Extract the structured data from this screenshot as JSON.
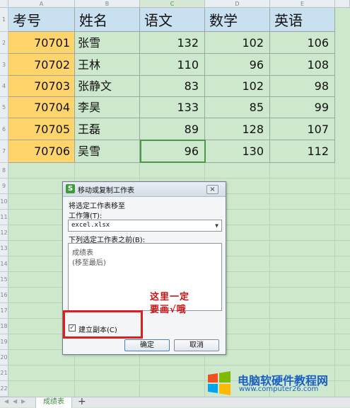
{
  "columns": [
    "A",
    "B",
    "C",
    "D",
    "E"
  ],
  "rows": [
    "1",
    "2",
    "3",
    "4",
    "5",
    "6",
    "7",
    "8",
    "9",
    "10",
    "11",
    "12",
    "13",
    "14",
    "15",
    "16",
    "17",
    "18",
    "19",
    "20",
    "21",
    "22"
  ],
  "table": {
    "headers": [
      "考号",
      "姓名",
      "语文",
      "数学",
      "英语"
    ],
    "records": [
      {
        "id": "70701",
        "name": "张雪",
        "chinese": "132",
        "math": "102",
        "english": "106"
      },
      {
        "id": "70702",
        "name": "王林",
        "chinese": "110",
        "math": "96",
        "english": "108"
      },
      {
        "id": "70703",
        "name": "张静文",
        "chinese": "83",
        "math": "102",
        "english": "98"
      },
      {
        "id": "70704",
        "name": "李昊",
        "chinese": "133",
        "math": "85",
        "english": "99"
      },
      {
        "id": "70705",
        "name": "王磊",
        "chinese": "89",
        "math": "128",
        "english": "107"
      },
      {
        "id": "70706",
        "name": "吴雪",
        "chinese": "96",
        "math": "130",
        "english": "112"
      }
    ]
  },
  "selected_column": "C",
  "dialog": {
    "title": "移动或复制工作表",
    "app_icon": "S",
    "close_icon": "×",
    "move_label": "将选定工作表移至",
    "workbook_label": "工作簿(T):",
    "workbook_value": "excel.xlsx",
    "before_label": "下列选定工作表之前(B):",
    "sheet_list": [
      "成绩表",
      "(移至最后)"
    ],
    "copy_label": "建立副本(C)",
    "copy_checked": true,
    "check_mark": "✓",
    "ok_label": "确定",
    "cancel_label": "取消"
  },
  "annotation": {
    "line1": "这里一定",
    "line2": "要画√哦"
  },
  "sheet_tabs": {
    "active": "成绩表",
    "add_icon": "+"
  },
  "watermark": {
    "title": "电脑软硬件教程网",
    "url": "www.computer26.com"
  },
  "colors": {
    "grid_bg": "#cde8cc",
    "header_bg": "#c9e0f0",
    "id_bg": "#ffd46a",
    "accent_red": "#e31d1d",
    "accent_green": "#4c9a47",
    "watermark_blue": "#1a5fc7"
  }
}
